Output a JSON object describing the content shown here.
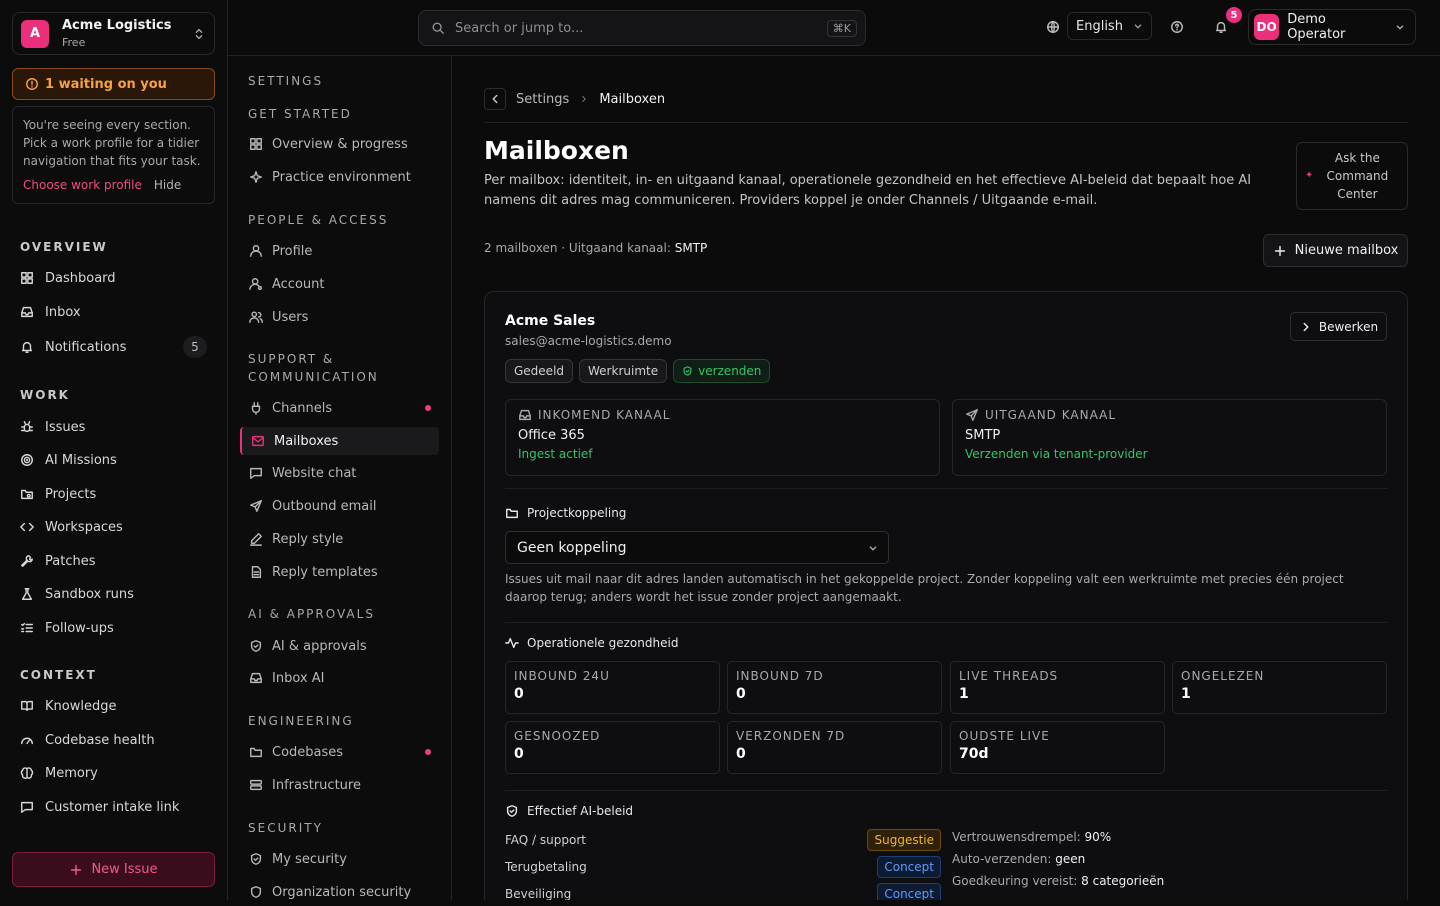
{
  "org": {
    "initial": "A",
    "name": "Acme Logistics",
    "plan": "Free"
  },
  "waiting": "1 waiting on you",
  "hint": {
    "text": "You're seeing every section. Pick a work profile for a tidier navigation that fits your task.",
    "choose": "Choose work profile",
    "hide": "Hide"
  },
  "overview": {
    "heading": "OVERVIEW",
    "items": [
      "Dashboard",
      "Inbox",
      "Notifications"
    ],
    "notifications_count": "5"
  },
  "work": {
    "heading": "WORK",
    "items": [
      "Issues",
      "AI Missions",
      "Projects",
      "Workspaces",
      "Patches",
      "Sandbox runs",
      "Follow-ups"
    ]
  },
  "context": {
    "heading": "CONTEXT",
    "items": [
      "Knowledge",
      "Codebase health",
      "Memory",
      "Customer intake link"
    ]
  },
  "new_issue": "New Issue",
  "topbar": {
    "search_placeholder": "Search or jump to...",
    "shortcut": "⌘K",
    "language": "English",
    "bell_count": "5",
    "user_initials": "DO",
    "user_name": "Demo Operator"
  },
  "settings": {
    "title": "SETTINGS",
    "groups": [
      {
        "heading": "GET STARTED",
        "items": [
          "Overview & progress",
          "Practice environment"
        ]
      },
      {
        "heading": "PEOPLE & ACCESS",
        "items": [
          "Profile",
          "Account",
          "Users"
        ]
      },
      {
        "heading": "SUPPORT & COMMUNICATION",
        "items": [
          "Channels",
          "Mailboxes",
          "Website chat",
          "Outbound email",
          "Reply style",
          "Reply templates"
        ]
      },
      {
        "heading": "AI & APPROVALS",
        "items": [
          "AI & approvals",
          "Inbox AI"
        ]
      },
      {
        "heading": "ENGINEERING",
        "items": [
          "Codebases",
          "Infrastructure"
        ]
      },
      {
        "heading": "SECURITY",
        "items": [
          "My security",
          "Organization security"
        ]
      }
    ]
  },
  "main": {
    "breadcrumb": {
      "parent": "Settings",
      "current": "Mailboxen"
    },
    "title": "Mailboxen",
    "description": "Per mailbox: identiteit, in- en uitgaand kanaal, operationele gezondheid en het effectieve AI-beleid dat bepaalt hoe AI namens dit adres mag communiceren. Providers koppel je onder Channels / Uitgaande e-mail.",
    "ask_cc": "Ask the Command Center",
    "count_text": "2 mailboxen · Uitgaand kanaal: ",
    "count_channel": "SMTP",
    "new_mailbox": "Nieuwe mailbox"
  },
  "mailbox": {
    "name": "Acme Sales",
    "email": "sales@acme-logistics.demo",
    "edit": "Bewerken",
    "tags": [
      "Gedeeld",
      "Werkruimte",
      "verzenden"
    ],
    "inbound": {
      "heading": "INKOMEND KANAAL",
      "value": "Office 365",
      "status": "Ingest actief"
    },
    "outbound": {
      "heading": "UITGAAND KANAAL",
      "value": "SMTP",
      "status": "Verzenden via tenant-provider"
    },
    "project": {
      "heading": "Projectkoppeling",
      "selected": "Geen koppeling",
      "note": "Issues uit mail naar dit adres landen automatisch in het gekoppelde project. Zonder koppeling valt een werkruimte met precies één project daarop terug; anders wordt het issue zonder project aangemaakt."
    },
    "health": {
      "heading": "Operationele gezondheid",
      "metrics": [
        {
          "label": "INBOUND 24U",
          "value": "0"
        },
        {
          "label": "INBOUND 7D",
          "value": "0"
        },
        {
          "label": "LIVE THREADS",
          "value": "1"
        },
        {
          "label": "ONGELEZEN",
          "value": "1"
        },
        {
          "label": "GESNOOZED",
          "value": "0"
        },
        {
          "label": "VERZONDEN 7D",
          "value": "0"
        },
        {
          "label": "OUDSTE LIVE",
          "value": "70d"
        }
      ]
    },
    "policy": {
      "heading": "Effectief AI-beleid",
      "rows": [
        {
          "label": "FAQ / support",
          "mode": "Suggestie"
        },
        {
          "label": "Terugbetaling",
          "mode": "Concept"
        },
        {
          "label": "Beveiliging",
          "mode": "Concept"
        }
      ],
      "threshold_label": "Vertrouwensdrempel: ",
      "threshold_value": "90%",
      "autosend_label": "Auto-verzenden: ",
      "autosend_value": "geen",
      "approval_label": "Goedkeuring vereist: ",
      "approval_value": "8 categorieën"
    }
  },
  "colors": {
    "accent": "#ec2f7a",
    "success": "#36c46a",
    "warning": "#f7a23c",
    "info": "#5e9bf5"
  }
}
